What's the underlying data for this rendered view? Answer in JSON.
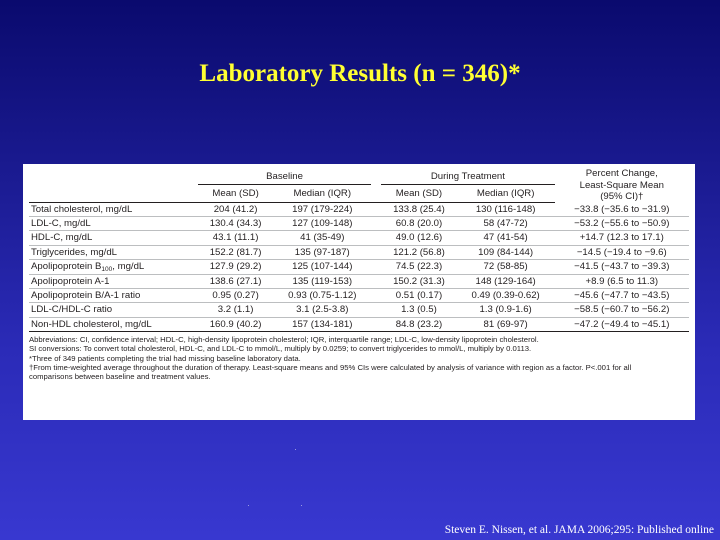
{
  "title": "Laboratory Results (n = 346)*",
  "table": {
    "groups": {
      "baseline": "Baseline",
      "treatment": "During Treatment"
    },
    "percent_header": [
      "Percent Change,",
      "Least-Square Mean",
      "(95% CI)†"
    ],
    "columns": [
      "Mean (SD)",
      "Median (IQR)",
      "Mean (SD)",
      "Median (IQR)"
    ],
    "rows": [
      {
        "label": "Total cholesterol, mg/dL",
        "b_mean": "204 (41.2)",
        "b_median": "197 (179-224)",
        "t_mean": "133.8 (25.4)",
        "t_median": "130 (116-148)",
        "pct": "−33.8 (−35.6 to −31.9)"
      },
      {
        "label": "LDL-C, mg/dL",
        "b_mean": "130.4 (34.3)",
        "b_median": "127 (109-148)",
        "t_mean": "60.8 (20.0)",
        "t_median": "58 (47-72)",
        "pct": "−53.2 (−55.6 to −50.9)"
      },
      {
        "label": "HDL-C, mg/dL",
        "b_mean": "43.1 (11.1)",
        "b_median": "41 (35-49)",
        "t_mean": "49.0 (12.6)",
        "t_median": "47 (41-54)",
        "pct": "+14.7 (12.3 to 17.1)"
      },
      {
        "label": "Triglycerides, mg/dL",
        "b_mean": "152.2 (81.7)",
        "b_median": "135 (97-187)",
        "t_mean": "121.2 (56.8)",
        "t_median": "109 (84-144)",
        "pct": "−14.5 (−19.4 to −9.6)"
      },
      {
        "label": "Apolipoprotein B",
        "label_sub": "100",
        "label_suffix": ", mg/dL",
        "b_mean": "127.9 (29.2)",
        "b_median": "125 (107-144)",
        "t_mean": "74.5 (22.3)",
        "t_median": "72 (58-85)",
        "pct": "−41.5 (−43.7 to −39.3)"
      },
      {
        "label": "Apolipoprotein A-1",
        "b_mean": "138.6 (27.1)",
        "b_median": "135 (119-153)",
        "t_mean": "150.2 (31.3)",
        "t_median": "148 (129-164)",
        "pct": "+8.9 (6.5 to 11.3)"
      },
      {
        "label": "Apolipoprotein B/A-1 ratio",
        "b_mean": "0.95 (0.27)",
        "b_median": "0.93 (0.75-1.12)",
        "t_mean": "0.51 (0.17)",
        "t_median": "0.49 (0.39-0.62)",
        "pct": "−45.6 (−47.7 to −43.5)"
      },
      {
        "label": "LDL-C/HDL-C ratio",
        "b_mean": "3.2 (1.1)",
        "b_median": "3.1 (2.5-3.8)",
        "t_mean": "1.3 (0.5)",
        "t_median": "1.3 (0.9-1.6)",
        "pct": "−58.5 (−60.7 to −56.2)"
      },
      {
        "label": "Non-HDL cholesterol, mg/dL",
        "b_mean": "160.9 (40.2)",
        "b_median": "157 (134-181)",
        "t_mean": "84.8 (23.2)",
        "t_median": "81 (69-97)",
        "pct": "−47.2 (−49.4 to −45.1)"
      }
    ],
    "notes": [
      "Abbreviations: CI, confidence interval; HDL-C, high-density lipoprotein cholesterol; IQR, interquartile range; LDL-C, low-density lipoprotein cholesterol.",
      "SI conversions: To convert total cholesterol, HDL-C, and LDL-C to mmol/L, multiply by 0.0259; to convert triglycerides to mmol/L, multiply by 0.0113.",
      "*Three of 349 patients completing the trial had missing baseline laboratory data.",
      "†From time-weighted average throughout the duration of therapy. Least-square means and 95% CIs were calculated by analysis of variance with region as a factor. P<.001 for all",
      "comparisons between baseline and treatment values."
    ]
  },
  "citation": "Steven E. Nissen, et al. JAMA 2006;295: Published online",
  "colors": {
    "title": "#ffff33",
    "background_top": "#0a0a6e",
    "background_bottom": "#3838d0",
    "citation": "#ffffff"
  }
}
